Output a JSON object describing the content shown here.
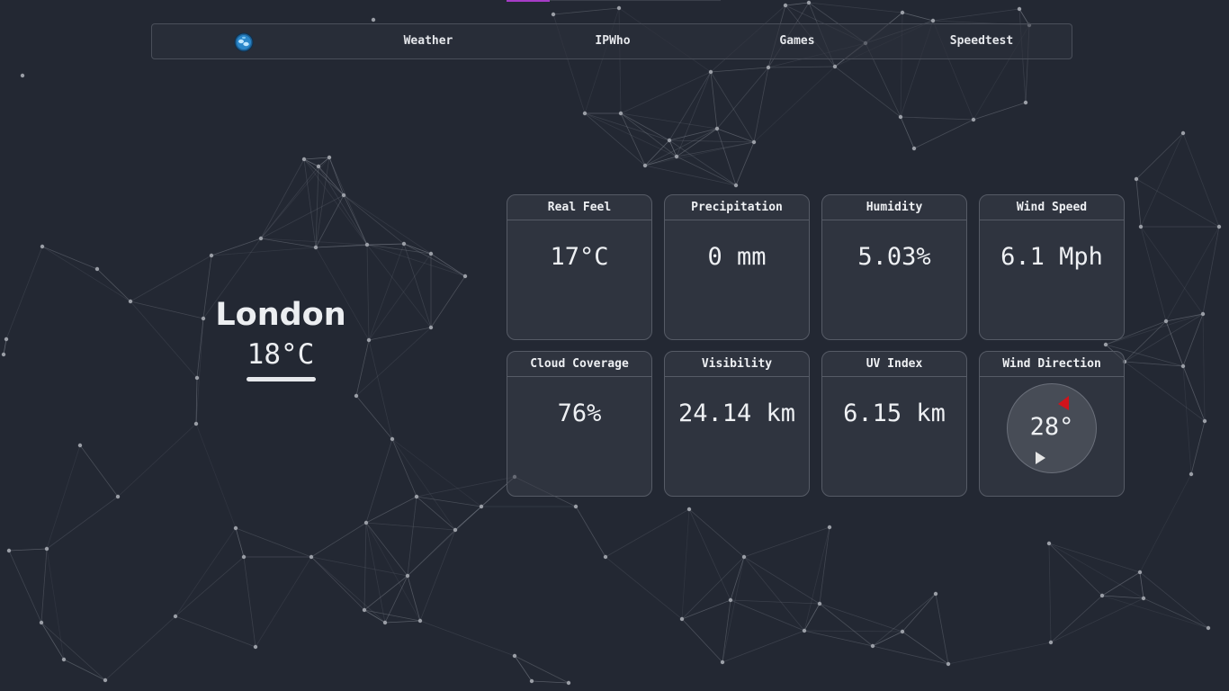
{
  "nav": {
    "logo_icon": "weather-globe-icon",
    "items": [
      {
        "label": "Weather"
      },
      {
        "label": "IPWho"
      },
      {
        "label": "Games"
      },
      {
        "label": "Speedtest"
      }
    ]
  },
  "location": {
    "city": "London",
    "temperature": "18°C"
  },
  "cards": [
    {
      "title": "Real Feel",
      "value": "17°C"
    },
    {
      "title": "Precipitation",
      "value": "0 mm"
    },
    {
      "title": "Humidity",
      "value": "5.03%"
    },
    {
      "title": "Wind Speed",
      "value": "6.1 Mph"
    },
    {
      "title": "Cloud Coverage",
      "value": "76%"
    },
    {
      "title": "Visibility",
      "value": "24.14 km"
    },
    {
      "title": "UV Index",
      "value": "6.15 km"
    },
    {
      "title": "Wind Direction",
      "value": "28°"
    }
  ],
  "colors": {
    "background": "#232833",
    "accent": "#a63cc7",
    "wind_arrow_head": "#d0131b",
    "wind_arrow_tail": "#e6e6e6"
  }
}
